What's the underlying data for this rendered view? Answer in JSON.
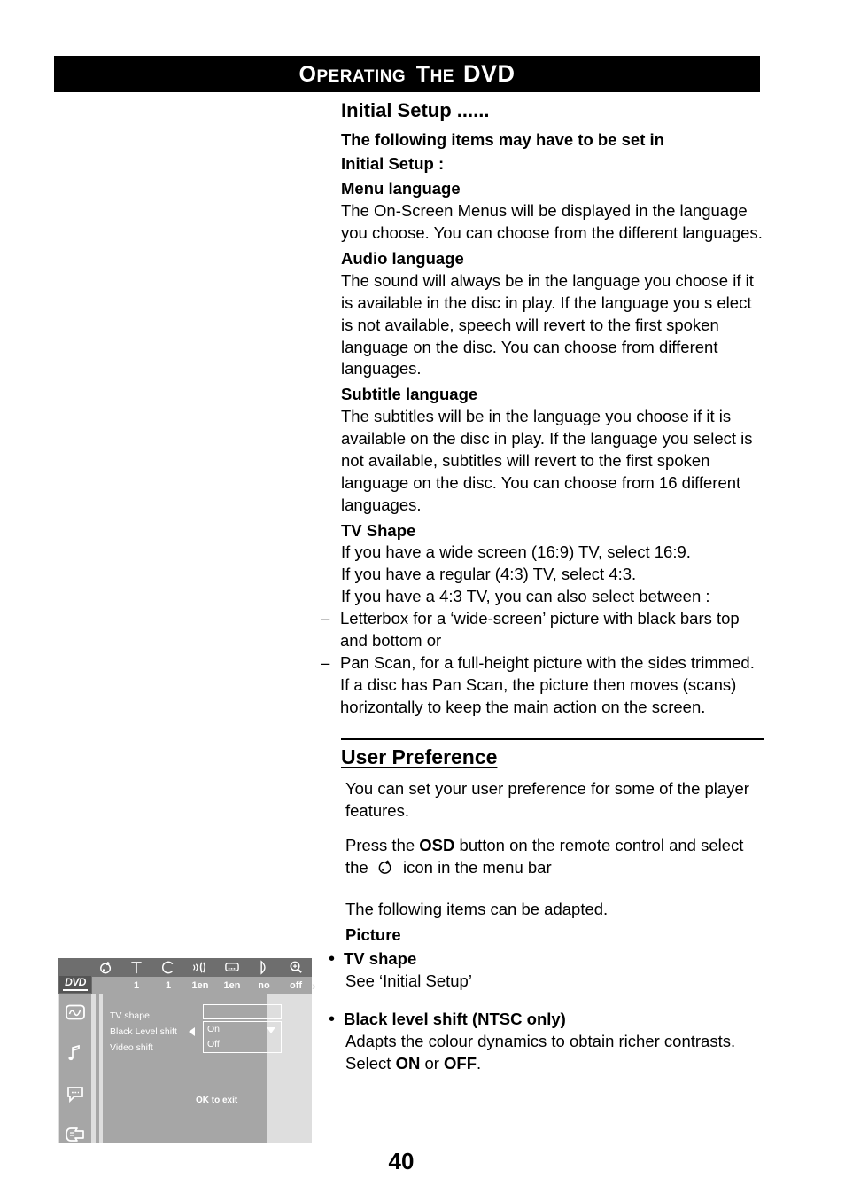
{
  "header": {
    "title_cap": "O",
    "title_sc": "PERATING  ",
    "title_the_cap": "T",
    "title_the_sc": "HE",
    "title_dvd": "DVD"
  },
  "content": {
    "initial_setup_heading": "Initial Setup ......",
    "lead_line1": "The following items may have to be set in",
    "lead_line2": "Initial Setup :",
    "menu_language_heading": "Menu language",
    "menu_language_body": "The On-Screen Menus will be displayed in the language you choose. You can choose from the different languages.",
    "audio_language_heading": "Audio language",
    "audio_language_body": "The sound will always be in the language you choose if it is available in the disc in play. If the  language you s elect is not available, speech will revert to the first spoken language on the disc. You can choose from different languages.",
    "subtitle_language_heading": "Subtitle language",
    "subtitle_language_body": "The subtitles will be in the language you choose if it is available on the disc in play. If the  language you select is not available, subtitles will revert to the first spoken language on the disc. You can choose from 16 different languages.",
    "tv_shape_heading": "TV Shape",
    "tv_shape_line1": "If you have a wide screen (16:9) TV, select 16:9.",
    "tv_shape_line2": "If you have a regular (4:3) TV, select 4:3.",
    "tv_shape_line3": "If you have a 4:3 TV, you can also select between :",
    "dash": "–",
    "letterbox_item": "Letterbox for a ‘wide-screen’ picture with black bars top and bottom or",
    "panscan_item": "Pan Scan, for a full-height picture with the sides trimmed. If a disc has Pan Scan, the picture then moves (scans) horizontally to keep the main action on the screen."
  },
  "user_preference": {
    "heading": "User Preference",
    "intro": "You can set your user preference for some of the player features.",
    "press_before": "Press the ",
    "press_osd": "OSD",
    "press_after": " button on the remote control and select the ",
    "press_tail": " icon in the menu bar",
    "adapted_line": "The following items can be adapted.",
    "picture_heading": "Picture",
    "bullet": "•",
    "tv_shape_bullet_label": "TV shape",
    "tv_shape_bullet_body": "See ‘Initial Setup’",
    "black_level_label": "Black level shift (NTSC only)",
    "black_level_body_before": "Adapts the colour dynamics to obtain richer contrasts. Select ",
    "black_level_on": "ON",
    "black_level_mid": " or ",
    "black_level_off": "OFF",
    "black_level_end": "."
  },
  "osd": {
    "logo": "DVD",
    "menubar": [
      {
        "icon": "user-preference-icon",
        "value": ""
      },
      {
        "icon": "title-icon",
        "value": "1"
      },
      {
        "icon": "chapter-icon",
        "value": "1"
      },
      {
        "icon": "audio-language-icon",
        "value": "1en"
      },
      {
        "icon": "subtitle-icon",
        "value": "1en"
      },
      {
        "icon": "angle-icon",
        "value": "no"
      },
      {
        "icon": "zoom-icon",
        "value": "off"
      }
    ],
    "more_arrow": "›",
    "sidebar_icons": [
      "picture-settings-icon",
      "sound-settings-icon",
      "language-settings-icon",
      "features-settings-icon"
    ],
    "rows": [
      {
        "label": "TV shape"
      },
      {
        "label": "Black Level shift"
      },
      {
        "label": "Video shift"
      }
    ],
    "dropdown_options": [
      "On",
      "Off"
    ],
    "dropdown_selected": "On",
    "exit_hint": "OK to exit"
  },
  "page": {
    "number": "40"
  },
  "colors": {
    "header_bar": "#000000",
    "osd_menubar": "#6e6e6e",
    "osd_panel": "#a6a6a6",
    "osd_background": "#dedede",
    "text": "#000000"
  }
}
